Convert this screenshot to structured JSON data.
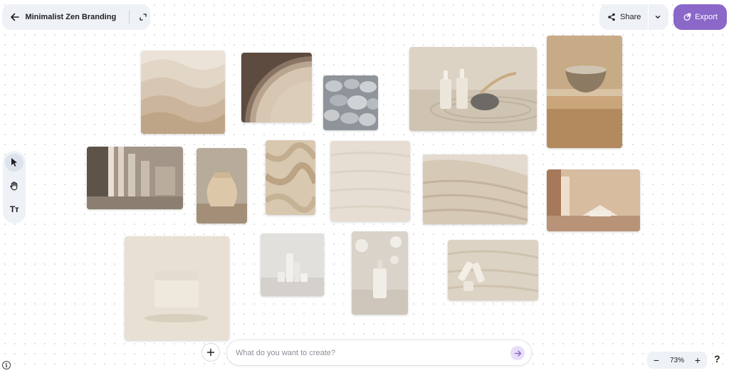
{
  "header": {
    "project_title": "Minimalist Zen Branding",
    "share_label": "Share",
    "export_label": "Export"
  },
  "toolbar": {
    "tools": [
      {
        "name": "select",
        "icon": "cursor-arrow-icon",
        "active": true
      },
      {
        "name": "pan",
        "icon": "hand-icon",
        "active": false
      },
      {
        "name": "text",
        "icon": "text-tool-icon",
        "label": "Tт",
        "active": false
      }
    ]
  },
  "canvas": {
    "images": [
      {
        "name": "sand-dune-waves-image"
      },
      {
        "name": "wood-rings-image"
      },
      {
        "name": "zen-stones-image"
      },
      {
        "name": "serum-bottles-sand-image"
      },
      {
        "name": "ceramic-bowl-wood-image"
      },
      {
        "name": "light-corridor-image"
      },
      {
        "name": "clay-vase-image"
      },
      {
        "name": "linen-fabric-image"
      },
      {
        "name": "wood-grain-texture-image"
      },
      {
        "name": "travertine-stone-image"
      },
      {
        "name": "minimal-room-image"
      },
      {
        "name": "cream-jar-image"
      },
      {
        "name": "product-lineup-image"
      },
      {
        "name": "serum-bottle-bokeh-image"
      },
      {
        "name": "bottles-on-stone-image"
      }
    ]
  },
  "prompt": {
    "placeholder": "What do you want to create?",
    "value": ""
  },
  "zoom": {
    "minus": "−",
    "level": "73%",
    "plus": "+"
  },
  "help_label": "?",
  "info_label": "i",
  "colors": {
    "accent": "#8a67c9",
    "panel": "#eef2f7",
    "send_bg": "#e8def8"
  }
}
